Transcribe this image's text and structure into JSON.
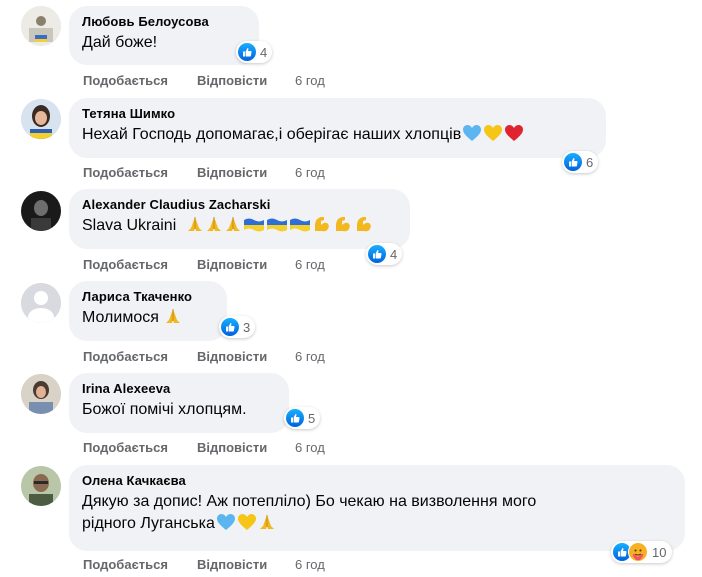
{
  "comments": [
    {
      "name": "Любовь Белоусова",
      "text": "Дай боже!",
      "reactions": "4",
      "like": "Подобається",
      "reply": "Відповісти",
      "time": "6 год"
    },
    {
      "name": "Тетяна Шимко",
      "text": "Нехай Господь допомагає,і оберігає наших хлопців",
      "reactions": "6",
      "like": "Подобається",
      "reply": "Відповісти",
      "time": "6 год"
    },
    {
      "name": "Alexander Claudius Zacharski",
      "text": "Slava Ukraini",
      "reactions": "4",
      "like": "Подобається",
      "reply": "Відповісти",
      "time": "6 год"
    },
    {
      "name": "Лариса Ткаченко",
      "text": "Молимося",
      "reactions": "3",
      "like": "Подобається",
      "reply": "Відповісти",
      "time": "6 год"
    },
    {
      "name": "Irina Alexeeva",
      "text": "Божої помічі хлопцям.",
      "reactions": "5",
      "like": "Подобається",
      "reply": "Відповісти",
      "time": "6 год"
    },
    {
      "name": "Олена Качкаєва",
      "text_line1": "Дякую за допис! Аж потепліло) Бо чекаю на визволення мого",
      "text_line2": "рідного Луганська",
      "reactions": "10",
      "like": "Подобається",
      "reply": "Відповісти",
      "time": "6 год"
    }
  ],
  "icons": {
    "reaction_like": "like-icon",
    "reaction_care": "care-icon",
    "emoji_pray": "folded-hands-icon",
    "emoji_blue_heart": "blue-heart-icon",
    "emoji_yellow_heart": "yellow-heart-icon",
    "emoji_red_heart": "red-heart-icon",
    "emoji_flag": "ukraine-flag-icon",
    "emoji_bicep": "flexed-biceps-icon"
  },
  "colors": {
    "bubble": "#f0f2f5",
    "like_blue": "#1877f2",
    "meta_gray": "#65676b"
  }
}
